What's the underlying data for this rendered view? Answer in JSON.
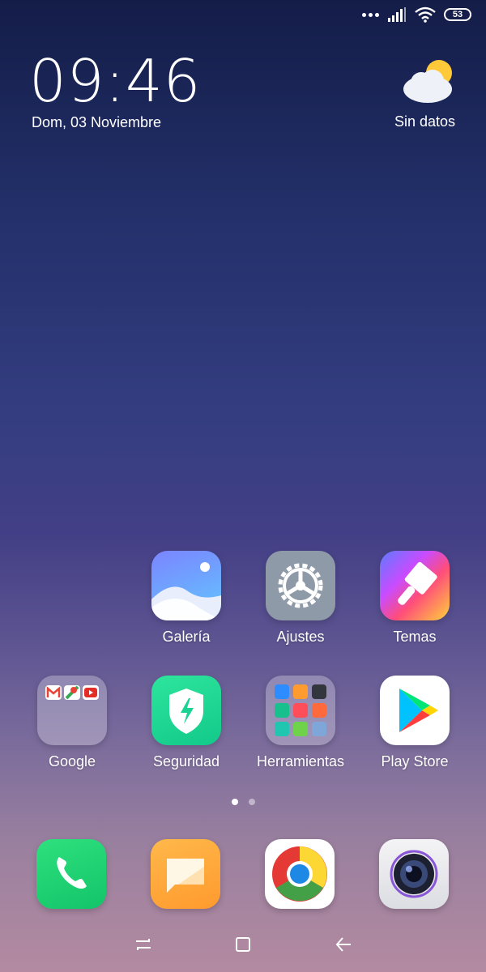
{
  "status_bar": {
    "battery_level": "53"
  },
  "clock": {
    "time": "09:46",
    "date": "Dom, 03 Noviembre"
  },
  "weather": {
    "text": "Sin datos",
    "icon": "partly-cloudy-icon"
  },
  "apps_row1": [
    {
      "label": "Galería",
      "icon": "gallery-icon"
    },
    {
      "label": "Ajustes",
      "icon": "settings-gear-icon"
    },
    {
      "label": "Temas",
      "icon": "themes-brush-icon"
    }
  ],
  "apps_row2": [
    {
      "label": "Google",
      "icon": "google-folder-icon"
    },
    {
      "label": "Seguridad",
      "icon": "security-shield-icon"
    },
    {
      "label": "Herramientas",
      "icon": "tools-folder-icon"
    },
    {
      "label": "Play Store",
      "icon": "play-store-icon"
    }
  ],
  "page_indicator": {
    "pages": 2,
    "current": 1
  },
  "dock": [
    {
      "icon": "phone-icon"
    },
    {
      "icon": "messages-icon"
    },
    {
      "icon": "chrome-icon"
    },
    {
      "icon": "camera-icon"
    }
  ],
  "colors": {
    "accent": "#ffffff",
    "security_green": "#1ad392",
    "phone_green": "#22d775",
    "messages_orange": "#ffa93c"
  }
}
